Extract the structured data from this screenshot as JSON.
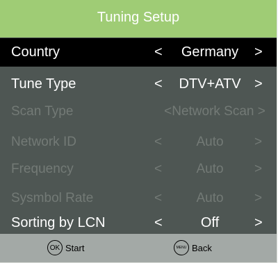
{
  "header": {
    "title": "Tuning Setup"
  },
  "rows": [
    {
      "label": "Country",
      "left_arrow": "<",
      "value": "Germany",
      "right_arrow": ">"
    },
    {
      "label": "Tune Type",
      "left_arrow": "<",
      "value": "DTV+ATV",
      "right_arrow": ">"
    },
    {
      "label": "Scan Type",
      "value": "<Network Scan >"
    },
    {
      "label": "Network ID",
      "left_arrow": "<",
      "value": "Auto",
      "right_arrow": ">"
    },
    {
      "label": "Frequency",
      "left_arrow": "<",
      "value": "Auto",
      "right_arrow": ">"
    },
    {
      "label": "Sysmbol Rate",
      "left_arrow": "<",
      "value": "Auto",
      "right_arrow": ">"
    },
    {
      "label": "Sorting by LCN",
      "left_arrow": "<",
      "value": "Off",
      "right_arrow": ">"
    }
  ],
  "footer": {
    "ok_icon": "OK",
    "ok_label": "Start",
    "menu_icon": "MENU",
    "menu_label": "Back"
  },
  "colors": {
    "header_bg": "#9fcc75",
    "panel_bg": "#4e5653",
    "selected_bg": "#000000",
    "disabled_text": "#737a76",
    "footer_bg": "#a3a9a6"
  }
}
